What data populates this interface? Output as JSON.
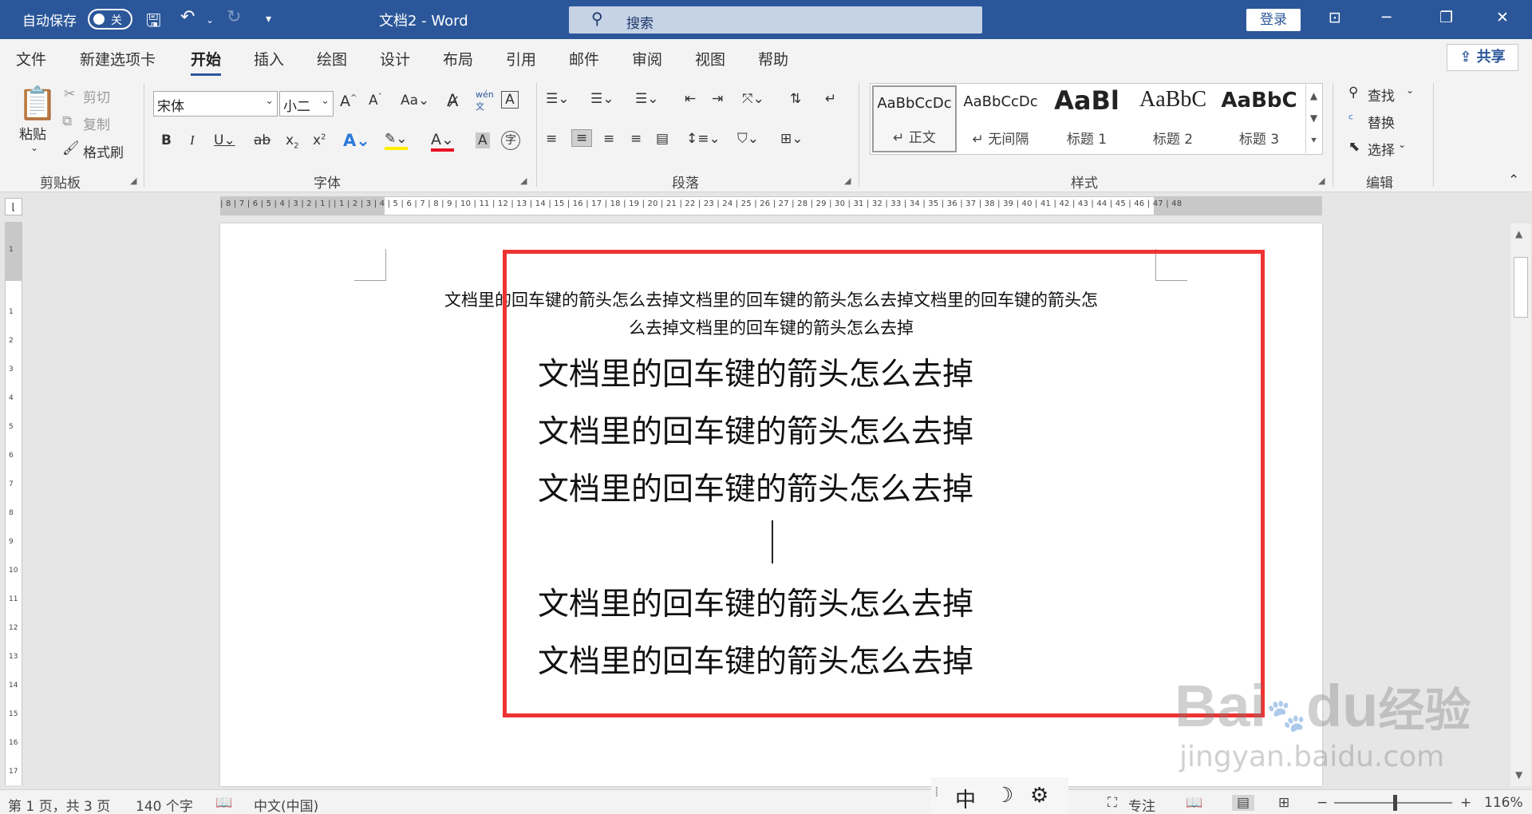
{
  "titlebar": {
    "autosave_label": "自动保存",
    "autosave_state": "关",
    "doc_title": "文档2 - Word",
    "search_placeholder": "搜索",
    "login_label": "登录"
  },
  "menu_tabs": [
    "文件",
    "新建选项卡",
    "开始",
    "插入",
    "绘图",
    "设计",
    "布局",
    "引用",
    "邮件",
    "审阅",
    "视图",
    "帮助"
  ],
  "active_tab": "开始",
  "share_label": "共享",
  "clipboard": {
    "paste": "粘贴",
    "cut": "剪切",
    "copy": "复制",
    "format_painter": "格式刷",
    "group_label": "剪贴板"
  },
  "font": {
    "family": "宋体",
    "size": "小二",
    "group_label": "字体"
  },
  "paragraph": {
    "group_label": "段落"
  },
  "styles": {
    "items": [
      {
        "sample": "AaBbCcDc",
        "name": "↵ 正文"
      },
      {
        "sample": "AaBbCcDc",
        "name": "↵ 无间隔"
      },
      {
        "sample": "AaBl",
        "name": "标题 1"
      },
      {
        "sample": "AaBbC",
        "name": "标题 2"
      },
      {
        "sample": "AaBbC",
        "name": "标题 3"
      }
    ],
    "group_label": "样式"
  },
  "editing": {
    "find": "查找",
    "replace": "替换",
    "select": "选择",
    "group_label": "编辑"
  },
  "ruler": {
    "numbers": "| 8 | 7 | 6 | 5 | 4 | 3 | 2 | 1 |   | 1 | 2 | 3 | 4 | 5 | 6 | 7 | 8 | 9 | 10 | 11 | 12 | 13 | 14 | 15 | 16 | 17 | 18 | 19 | 20 | 21 | 22 | 23 | 24 | 25 | 26 | 27 | 28 | 29 | 30 | 31 | 32 | 33 | 34 | 35 | 36 | 37 | 38 | 39 | 40 | 41 | 42 | 43 | 44 | 45 | 46 | 47 | 48"
  },
  "document": {
    "heading_line_1": "文档里的回车键的箭头怎么去掉文档里的回车键的箭头怎么去掉文档里的回车键的箭头怎",
    "heading_line_2": "么去掉文档里的回车键的箭头怎么去掉",
    "line_1": "文档里的回车键的箭头怎么去掉",
    "line_2": "文档里的回车键的箭头怎么去掉",
    "line_3": "文档里的回车键的箭头怎么去掉",
    "line_4": "文档里的回车键的箭头怎么去掉",
    "line_5": "文档里的回车键的箭头怎么去掉"
  },
  "status": {
    "page": "第 1 页，共 3 页",
    "words": "140 个字",
    "language": "中文(中国)",
    "focus": "专注",
    "zoom": "116%"
  },
  "ime": {
    "mode": "中"
  },
  "watermark": {
    "brand": "Bai",
    "brand2": "du",
    "product": "经验",
    "url": "jingyan.baidu.com"
  },
  "colors": {
    "brand_blue": "#2b579a",
    "highlight_red": "#ee3333"
  }
}
